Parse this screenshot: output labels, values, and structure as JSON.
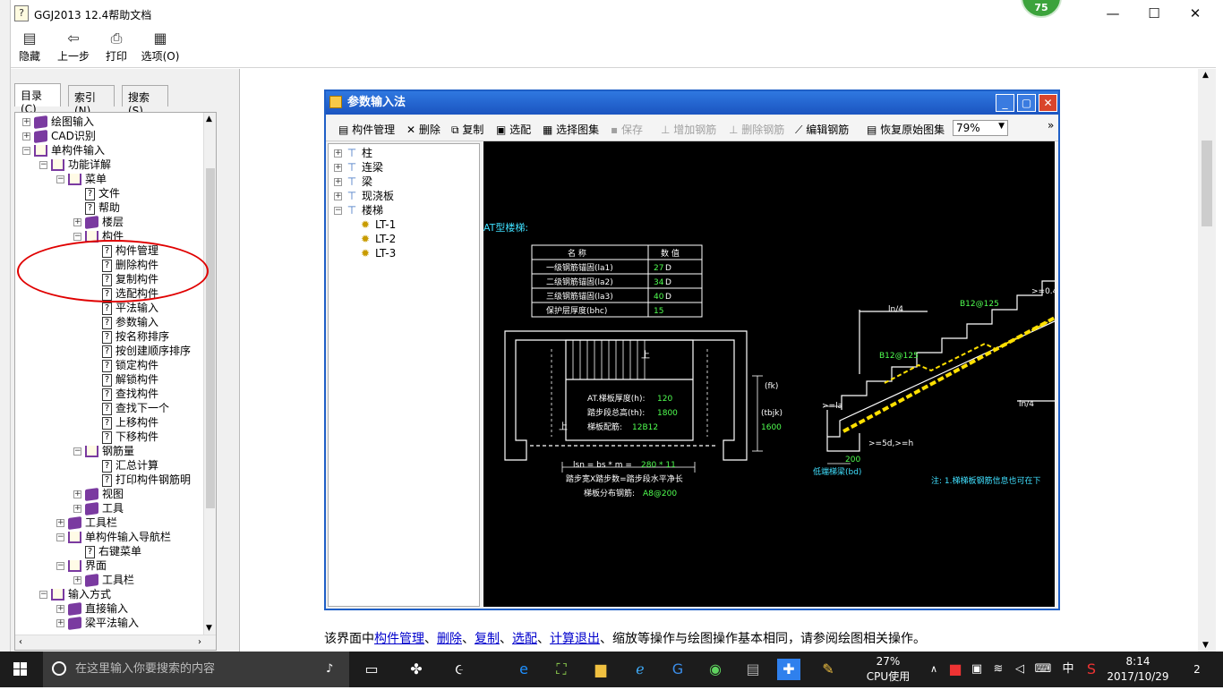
{
  "window": {
    "title": "GGJ2013 12.4帮助文档",
    "badge": "75",
    "minimize": "—",
    "maximize": "☐",
    "close": "✕"
  },
  "toolbar": {
    "hide": "隐藏",
    "back": "上一步",
    "print": "打印",
    "options": "选项(O)"
  },
  "tabs": {
    "contents": "目录(C)",
    "index": "索引(N)",
    "search": "搜索(S)"
  },
  "tree": [
    {
      "label": "绘图输入",
      "exp": "+",
      "icon": "book"
    },
    {
      "label": "CAD识别",
      "exp": "+",
      "icon": "book"
    },
    {
      "label": "单构件输入",
      "exp": "−",
      "icon": "open"
    },
    {
      "label": "功能详解",
      "exp": "−",
      "icon": "open"
    },
    {
      "label": "菜单",
      "exp": "−",
      "icon": "open"
    },
    {
      "label": "文件",
      "exp": "",
      "icon": "page"
    },
    {
      "label": "帮助",
      "exp": "",
      "icon": "page"
    },
    {
      "label": "楼层",
      "exp": "+",
      "icon": "book"
    },
    {
      "label": "构件",
      "exp": "−",
      "icon": "open"
    },
    {
      "label": "构件管理",
      "exp": "",
      "icon": "page"
    },
    {
      "label": "删除构件",
      "exp": "",
      "icon": "page"
    },
    {
      "label": "复制构件",
      "exp": "",
      "icon": "page"
    },
    {
      "label": "选配构件",
      "exp": "",
      "icon": "page"
    },
    {
      "label": "平法输入",
      "exp": "",
      "icon": "page"
    },
    {
      "label": "参数输入",
      "exp": "",
      "icon": "page"
    },
    {
      "label": "按名称排序",
      "exp": "",
      "icon": "page"
    },
    {
      "label": "按创建顺序排序",
      "exp": "",
      "icon": "page"
    },
    {
      "label": "锁定构件",
      "exp": "",
      "icon": "page"
    },
    {
      "label": "解锁构件",
      "exp": "",
      "icon": "page"
    },
    {
      "label": "查找构件",
      "exp": "",
      "icon": "page"
    },
    {
      "label": "查找下一个",
      "exp": "",
      "icon": "page"
    },
    {
      "label": "上移构件",
      "exp": "",
      "icon": "page"
    },
    {
      "label": "下移构件",
      "exp": "",
      "icon": "page"
    },
    {
      "label": "钢筋量",
      "exp": "−",
      "icon": "open"
    },
    {
      "label": "汇总计算",
      "exp": "",
      "icon": "page"
    },
    {
      "label": "打印构件钢筋明",
      "exp": "",
      "icon": "page"
    },
    {
      "label": "视图",
      "exp": "+",
      "icon": "book"
    },
    {
      "label": "工具",
      "exp": "+",
      "icon": "book"
    },
    {
      "label": "工具栏",
      "exp": "+",
      "icon": "book"
    },
    {
      "label": "单构件输入导航栏",
      "exp": "−",
      "icon": "open"
    },
    {
      "label": "右键菜单",
      "exp": "",
      "icon": "page"
    },
    {
      "label": "界面",
      "exp": "−",
      "icon": "open"
    },
    {
      "label": "工具栏",
      "exp": "+",
      "icon": "book"
    },
    {
      "label": "输入方式",
      "exp": "−",
      "icon": "open"
    },
    {
      "label": "直接输入",
      "exp": "+",
      "icon": "book"
    },
    {
      "label": "梁平法输入",
      "exp": "+",
      "icon": "book"
    }
  ],
  "dialog": {
    "title": "参数输入法",
    "tools": {
      "manage": "构件管理",
      "delete": "删除",
      "copy": "复制",
      "select": "选配",
      "select_set": "选择图集",
      "save": "保存",
      "add_rebar": "增加钢筋",
      "del_rebar": "删除钢筋",
      "edit_rebar": "编辑钢筋",
      "restore": "恢复原始图集",
      "zoom": "79%"
    },
    "tree": [
      "柱",
      "连梁",
      "梁",
      "现浇板",
      "楼梯",
      "LT-1",
      "LT-2",
      "LT-3"
    ]
  },
  "cad": {
    "heading": "AT型楼梯:",
    "table_head": [
      "名 称",
      "数 值"
    ],
    "table_rows": [
      [
        "一级钢筋锚固(la1)",
        "27",
        "D"
      ],
      [
        "二级钢筋锚固(la2)",
        "34",
        "D"
      ],
      [
        "三级钢筋锚固(la3)",
        "40",
        "D"
      ],
      [
        "保护层厚度(bhc)",
        "15",
        ""
      ]
    ],
    "plan_up1": "上",
    "plan_up2": "上",
    "plan_info": [
      "AT.梯板厚度(h):",
      "120",
      "踏步段总高(th):",
      "1800",
      "梯板配筋:",
      "12B12"
    ],
    "fk": "(fk)",
    "tbjk": "(tbjk)",
    "h1600": "1600",
    "lsn_label": "lsn = bs * m =",
    "lsn_val": "280 * 11",
    "tread_note": "踏步宽X踏步数=踏步段水平净长",
    "dist_label": "梯板分布钢筋:",
    "dist_val": "A8@200",
    "ln4a": "ln/4",
    "ln4b": "ln/4",
    "b12a": "B12@125",
    "b12b": "B12@125",
    "gte0": ">=0.4",
    "gtel": ">=la",
    "gte5d": ">=5d,>=h",
    "dim200": "200",
    "base_w": "低端梯梁(bd)",
    "note": "注: 1.梯梯板钢筋信息也可在下"
  },
  "body": {
    "prefix": "该界面中",
    "l1": "构件管理",
    "s1": "、",
    "l2": "删除",
    "s2": "、",
    "l3": "复制",
    "s3": "、",
    "l4": "选配",
    "s4": "、",
    "l5": "计算退出",
    "suffix": "、缩放等操作与绘图操作基本相同，请参阅绘图相关操作。"
  },
  "taskbar": {
    "search_placeholder": "在这里输入你要搜索的内容",
    "cpu_pct": "27%",
    "cpu_label": "CPU使用",
    "ime": "中",
    "time": "8:14",
    "date": "2017/10/29",
    "notif": "2"
  }
}
